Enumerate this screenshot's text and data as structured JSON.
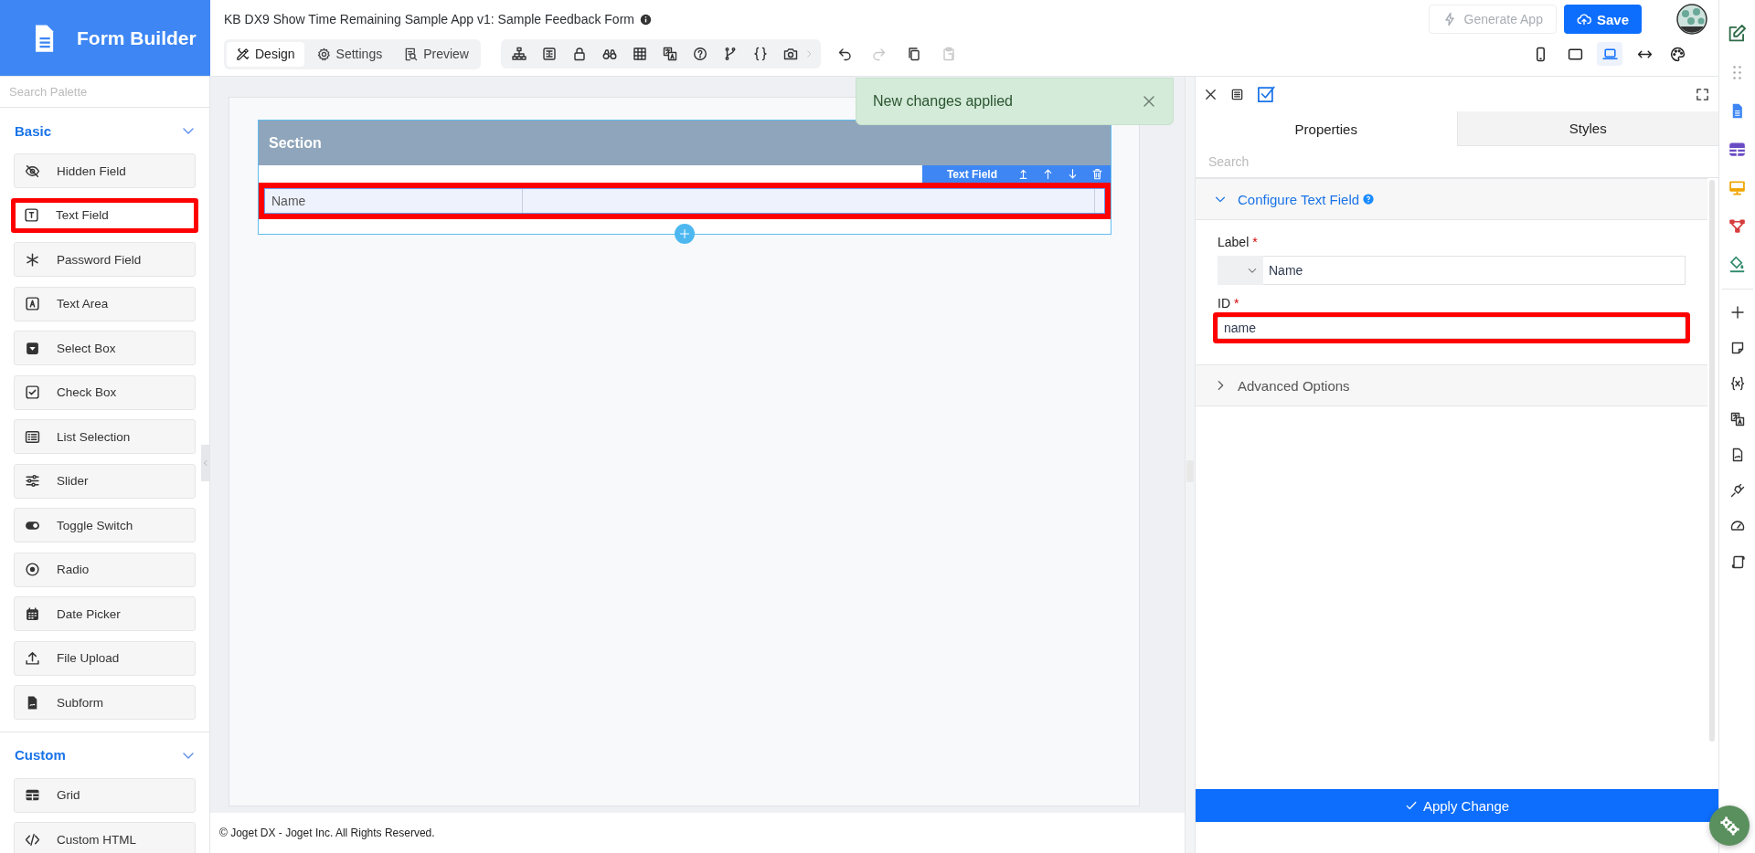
{
  "app": {
    "title": "Form Builder"
  },
  "header": {
    "title": "KB DX9 Show Time Remaining Sample App v1: Sample Feedback Form",
    "mode_tabs": [
      {
        "label": "Design",
        "selected": true
      },
      {
        "label": "Settings",
        "selected": false
      },
      {
        "label": "Preview",
        "selected": false
      }
    ],
    "generate_button": {
      "label": "Generate App",
      "disabled": true
    },
    "save_button": {
      "label": "Save"
    },
    "device_views": [
      {
        "selected": false
      },
      {
        "selected": false
      },
      {
        "selected": true
      },
      {
        "selected": false
      }
    ]
  },
  "palette": {
    "search_placeholder": "Search Palette",
    "groups": [
      {
        "title": "Basic",
        "expanded": true,
        "items": [
          {
            "label": "Hidden Field",
            "highlighted": false
          },
          {
            "label": "Text Field",
            "highlighted": true
          },
          {
            "label": "Password Field",
            "highlighted": false
          },
          {
            "label": "Text Area",
            "highlighted": false
          },
          {
            "label": "Select Box",
            "highlighted": false
          },
          {
            "label": "Check Box",
            "highlighted": false
          },
          {
            "label": "List Selection",
            "highlighted": false
          },
          {
            "label": "Slider",
            "highlighted": false
          },
          {
            "label": "Toggle Switch",
            "highlighted": false
          },
          {
            "label": "Radio",
            "highlighted": false
          },
          {
            "label": "Date Picker",
            "highlighted": false
          },
          {
            "label": "File Upload",
            "highlighted": false
          },
          {
            "label": "Subform",
            "highlighted": false
          }
        ]
      },
      {
        "title": "Custom",
        "expanded": true,
        "items": [
          {
            "label": "Grid",
            "highlighted": false
          },
          {
            "label": "Custom HTML",
            "highlighted": false
          }
        ]
      }
    ]
  },
  "canvas": {
    "section": {
      "title": "Section",
      "field_toolbar": {
        "label": "Text Field"
      },
      "fields": [
        {
          "label": "Name",
          "highlighted": true
        }
      ]
    }
  },
  "toast": {
    "message": "New changes applied"
  },
  "properties": {
    "tabs": [
      {
        "label": "Properties",
        "selected": true
      },
      {
        "label": "Styles",
        "selected": false
      }
    ],
    "search_placeholder": "Search",
    "sections": [
      {
        "title": "Configure Text Field",
        "expanded": true,
        "fields": [
          {
            "kind": "language",
            "label": "Label",
            "required_mark": "*",
            "value": "Name",
            "highlighted": false
          },
          {
            "kind": "text",
            "label": "ID",
            "required_mark": "*",
            "value": "name",
            "highlighted": true
          }
        ]
      },
      {
        "title": "Advanced Options",
        "expanded": false
      }
    ],
    "apply_button": "Apply Change"
  },
  "footer": "© Joget DX - Joget Inc. All Rights Reserved."
}
